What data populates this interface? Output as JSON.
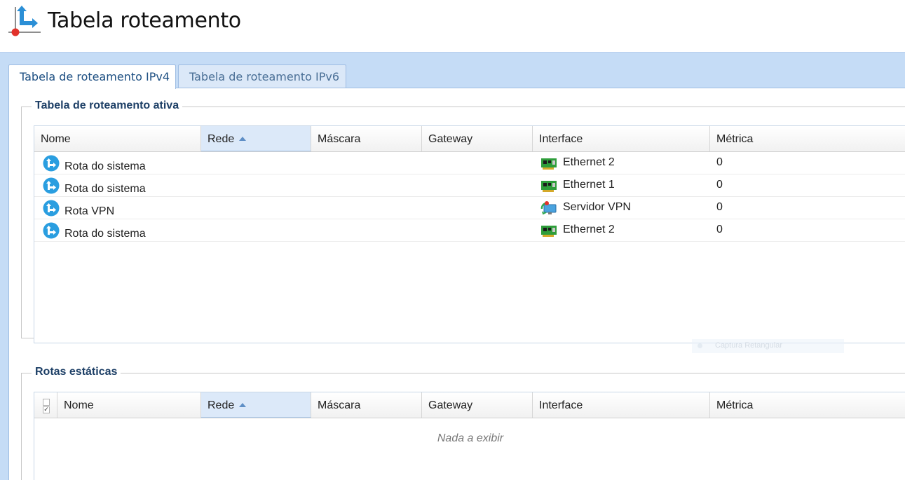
{
  "header": {
    "title": "Tabela roteamento",
    "icon": "routing-table-icon"
  },
  "tabs": [
    {
      "label": "Tabela de roteamento IPv4",
      "active": true
    },
    {
      "label": "Tabela de roteamento IPv6",
      "active": false
    }
  ],
  "active_table": {
    "legend": "Tabela de roteamento ativa",
    "columns": [
      "Nome",
      "Rede",
      "Máscara",
      "Gateway",
      "Interface",
      "Métrica"
    ],
    "sorted_column": "Rede",
    "rows": [
      {
        "name": "Rota do sistema",
        "rede": "",
        "mascara": "",
        "gateway": "",
        "interface": "Ethernet 2",
        "interface_icon": "network-card-icon",
        "metrica": "0"
      },
      {
        "name": "Rota do sistema",
        "rede": "",
        "mascara": "",
        "gateway": "",
        "interface": "Ethernet 1",
        "interface_icon": "network-card-icon",
        "metrica": "0"
      },
      {
        "name": "Rota VPN",
        "rede": "",
        "mascara": "",
        "gateway": "",
        "interface": "Servidor VPN",
        "interface_icon": "vpn-server-icon",
        "metrica": "0"
      },
      {
        "name": "Rota do sistema",
        "rede": "",
        "mascara": "",
        "gateway": "",
        "interface": "Ethernet 2",
        "interface_icon": "network-card-icon",
        "metrica": "0"
      }
    ]
  },
  "static_routes": {
    "legend": "Rotas estáticas",
    "columns": [
      "Nome",
      "Rede",
      "Máscara",
      "Gateway",
      "Interface",
      "Métrica"
    ],
    "sorted_column": "Rede",
    "empty_text": "Nada a exibir"
  },
  "overlay": {
    "text": "Captura Retangular"
  },
  "colors": {
    "band": "#c5dcf6",
    "legend": "#1d3f66",
    "sorted_header": "#dce9f9",
    "route_icon": "#2a9ee0"
  }
}
